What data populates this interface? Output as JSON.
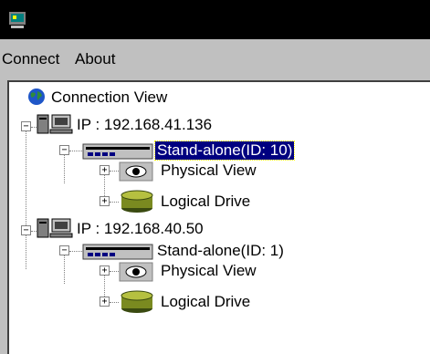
{
  "menu": {
    "items": [
      "Connect",
      "About"
    ]
  },
  "tree": {
    "root": "Connection View",
    "hosts": [
      {
        "ip": "IP : 192.168.41.136",
        "controller": "Stand-alone(ID: 10)",
        "controller_selected": true,
        "children": [
          "Physical View",
          "Logical Drive"
        ]
      },
      {
        "ip": "IP : 192.168.40.50",
        "controller": "Stand-alone(ID: 1)",
        "controller_selected": false,
        "children": [
          "Physical View",
          "Logical Drive"
        ]
      }
    ]
  },
  "colors": {
    "selection": "#000080",
    "window_bg": "#c0c0c0",
    "titlebar": "#000000"
  }
}
